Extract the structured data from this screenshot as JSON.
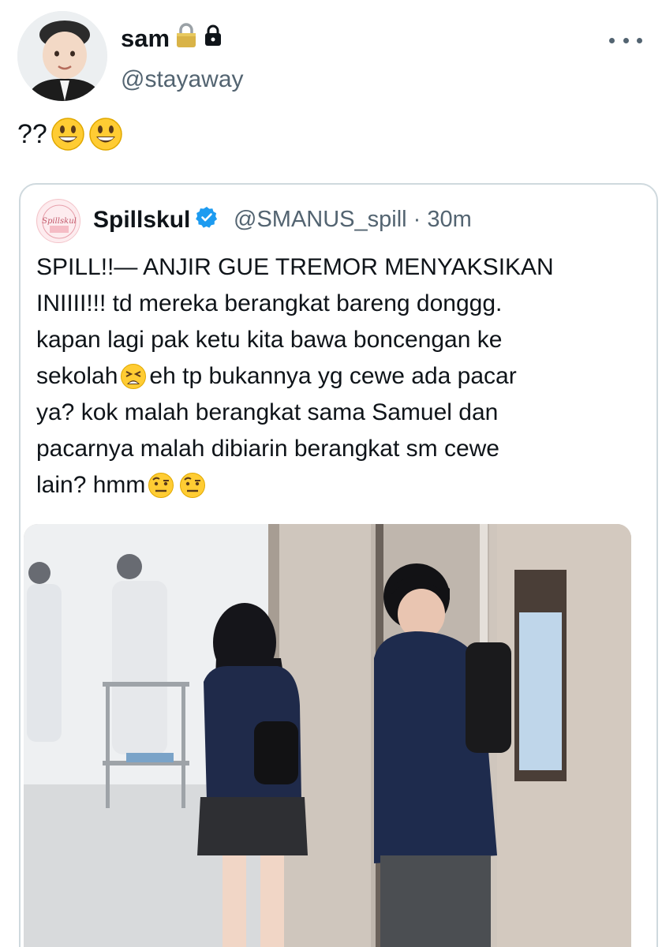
{
  "author": {
    "display_name": "sam",
    "handle": "@stayaway",
    "avatar": "child-portrait-avatar",
    "badges": [
      "padlock-emoji",
      "lock-icon"
    ]
  },
  "tweet": {
    "text": "??",
    "emojis": [
      "grinning-face-emoji",
      "grinning-face-emoji"
    ]
  },
  "quote": {
    "display_name": "Spillskul",
    "handle": "@SMANUS_spill",
    "separator": "·",
    "time": "30m",
    "verified_icon": "verified-badge-icon",
    "avatar_text": "Spillskul",
    "lines": [
      "SPILL!!— ANJIR GUE TREMOR MENYAKSIKAN",
      "INIIII!!! td mereka berangkat bareng donggg.",
      "kapan lagi pak ketu kita bawa boncengan ke",
      "sekolah",
      "eh tp bukannya yg cewe ada pacar",
      "ya? kok malah berangkat sama Samuel dan",
      "pacarnya malah dibiarin berangkat sm cewe",
      "lain? hmm"
    ],
    "media": "photo-two-students-walking-hallway"
  },
  "colors": {
    "text": "#0f1419",
    "secondary": "#536471",
    "border": "#cfd9de",
    "verified": "#1d9bf0"
  }
}
